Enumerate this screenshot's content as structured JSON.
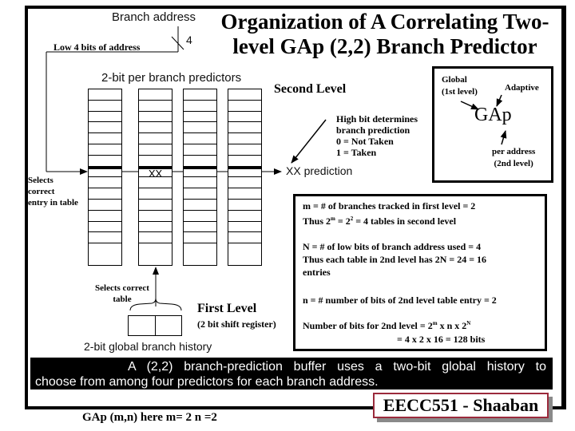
{
  "slide": {
    "title": "Organization of A Correlating Two-level GAp (2,2) Branch Predictor",
    "title_line1": "Organization of A Correlating Two-",
    "title_line2": "level GAp (2,2) Branch Predictor"
  },
  "diagram": {
    "branch_address_label": "Branch address",
    "bus_width_label": "4",
    "low_bits_label": "Low 4 bits of address",
    "predictors_label": "2-bit per branch predictors",
    "second_level_label": "Second Level",
    "selects_entry_label_lines": [
      "Selects",
      "correct",
      "entry in table"
    ],
    "selected_entry_value": "XX",
    "prediction_label": "XX prediction",
    "high_bit_note_lines": [
      "High bit determines",
      "branch prediction",
      "0  =  Not Taken",
      "1 =  Taken"
    ],
    "selects_table_label_lines": [
      "Selects correct",
      "table"
    ],
    "first_level_label": "First Level",
    "shift_register_label": "(2 bit shift register)",
    "history_label": "2-bit global branch history",
    "table_count": 4,
    "entries_per_table": 16,
    "selected_entry_index": 8,
    "selected_table_index": 1,
    "history_bits": 2
  },
  "gap_box": {
    "global_label_lines": [
      "Global",
      "(1st level)"
    ],
    "adaptive_label": "Adaptive",
    "center_label": "GAp",
    "per_address_label_lines": [
      "per address",
      "(2nd level)"
    ]
  },
  "info_box": {
    "m_line": "m =  # of  branches tracked  in first level  = 2",
    "thus_tables_prefix": "Thus  2",
    "thus_tables_sup1": "m",
    "thus_tables_mid": "  =  2",
    "thus_tables_sup2": "2",
    "thus_tables_suffix": " = 4   tables in second level",
    "n_cap_line": "N = # of low bits of branch address used  = 4",
    "thus_entries_line1": "Thus each table in 2nd level  has  2N  = 24 = 16",
    "thus_entries_line2": "entries",
    "n_line": "n =  #  number of bits of 2nd level table entry = 2",
    "bits_prefix": "Number of bits for 2nd level = 2",
    "bits_sup1": "m",
    "bits_mid": " x  n x 2",
    "bits_sup2": "N",
    "bits_result": "=  4  x  2 x  16 = 128 bits"
  },
  "caption": {
    "line1": "A (2,2) branch-prediction buffer uses a two-bit global history to",
    "line2": "choose from among four predictors for each branch address."
  },
  "footer": {
    "note": "GAp (m,n)   here   m= 2     n =2",
    "badge": "EECC551 - Shaaban",
    "badge_border_color": "#9b2a3c"
  }
}
